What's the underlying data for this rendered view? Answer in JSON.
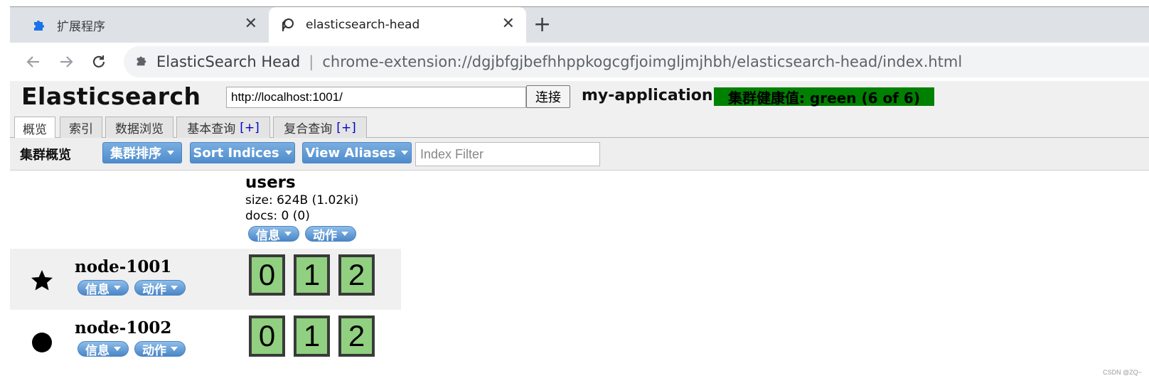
{
  "browser": {
    "tabs": [
      {
        "title": "扩展程序",
        "icon": "puzzle-icon",
        "active": false
      },
      {
        "title": "elasticsearch-head",
        "icon": "elasticsearch-head-icon",
        "active": true
      }
    ],
    "site_name": "ElasticSearch Head",
    "url": "chrome-extension://dgjbfgjbefhhppkogcgfjoimgljmjhbh/elasticsearch-head/index.html"
  },
  "header": {
    "title": "Elasticsearch",
    "server_url": "http://localhost:1001/",
    "connect_label": "连接",
    "cluster_name": "my-application",
    "health_text": "集群健康值: green (6 of 6)",
    "health_color": "#008000"
  },
  "tabs": [
    {
      "label": "概览",
      "plus": ""
    },
    {
      "label": "索引",
      "plus": ""
    },
    {
      "label": "数据浏览",
      "plus": ""
    },
    {
      "label": "基本查询",
      "plus": "[+]"
    },
    {
      "label": "复合查询",
      "plus": "[+]"
    }
  ],
  "overview": {
    "title": "集群概览",
    "cluster_sort_label": "集群排序",
    "sort_indices_label": "Sort Indices",
    "view_aliases_label": "View Aliases",
    "index_filter_placeholder": "Index Filter",
    "index": {
      "name": "users",
      "size": "size: 624B (1.02ki)",
      "docs": "docs: 0 (0)",
      "info_label": "信息",
      "action_label": "动作"
    },
    "nodes": [
      {
        "name": "node-1001",
        "marker": "star-icon",
        "info_label": "信息",
        "action_label": "动作",
        "shards": [
          "0",
          "1",
          "2"
        ]
      },
      {
        "name": "node-1002",
        "marker": "circle-icon",
        "info_label": "信息",
        "action_label": "动作",
        "shards": [
          "0",
          "1",
          "2"
        ]
      }
    ],
    "shard_color": "#90d080"
  },
  "watermark": "CSDN @ZQ~"
}
